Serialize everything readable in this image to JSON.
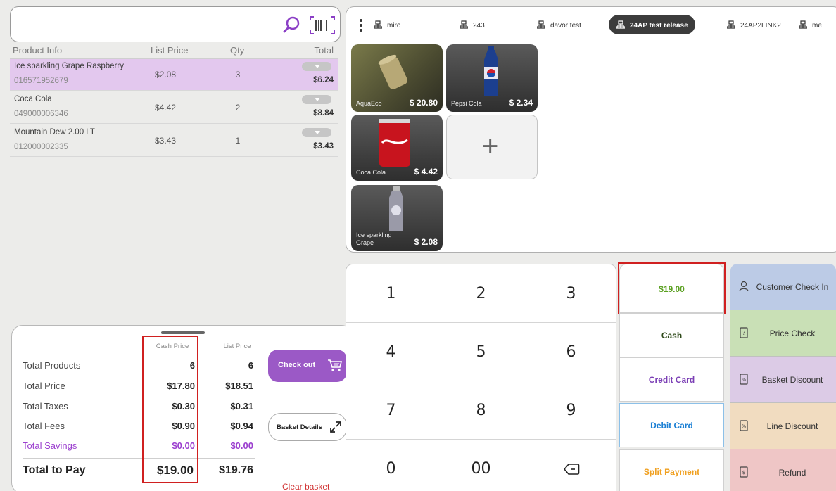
{
  "search": {
    "placeholder": ""
  },
  "basket": {
    "headers": {
      "product": "Product Info",
      "list_price": "List Price",
      "qty": "Qty",
      "total": "Total"
    },
    "rows": [
      {
        "name": "Ice sparkling Grape Raspberry",
        "code": "016571952679",
        "price": "$2.08",
        "qty": "3",
        "total": "$6.24",
        "selected": true
      },
      {
        "name": "Coca Cola",
        "code": "049000006346",
        "price": "$4.42",
        "qty": "2",
        "total": "$8.84",
        "selected": false
      },
      {
        "name": "Mountain Dew 2.00 LT",
        "code": "012000002335",
        "price": "$3.43",
        "qty": "1",
        "total": "$3.43",
        "selected": false
      }
    ]
  },
  "totals": {
    "cash_header": "Cash Price",
    "list_header": "List Price",
    "rows": [
      {
        "label": "Total Products",
        "cash": "6",
        "list": "6"
      },
      {
        "label": "Total Price",
        "cash": "$17.80",
        "list": "$18.51"
      },
      {
        "label": "Total Taxes",
        "cash": "$0.30",
        "list": "$0.31"
      },
      {
        "label": "Total Fees",
        "cash": "$0.90",
        "list": "$0.94"
      },
      {
        "label": "Total Savings",
        "cash": "$0.00",
        "list": "$0.00"
      }
    ],
    "grand_label": "Total to Pay",
    "grand_cash": "$19.00",
    "grand_list": "$19.76",
    "checkout_label": "Check out",
    "basket_details_label": "Basket Details",
    "clear_basket_label": "Clear basket"
  },
  "tabs": [
    {
      "label": "miro"
    },
    {
      "label": "243"
    },
    {
      "label": "davor test"
    },
    {
      "label": "24AP test release",
      "active": true
    },
    {
      "label": "24AP2LINK2"
    },
    {
      "label": "me"
    }
  ],
  "tiles": [
    {
      "name": "AquaEco",
      "price": "$ 20.80",
      "icon": "can-image"
    },
    {
      "name": "Pepsi Cola",
      "price": "$ 2.34",
      "icon": "bottle-image"
    },
    {
      "name": "Coca Cola",
      "price": "$ 4.42",
      "icon": "can-image"
    },
    {
      "name": "Ice sparkling Grape",
      "price": "$ 2.08",
      "icon": "bottle-image"
    }
  ],
  "add_tile": {
    "label": "+"
  },
  "numpad": [
    "1",
    "2",
    "3",
    "4",
    "5",
    "6",
    "7",
    "8",
    "9",
    "0",
    "00",
    "backspace"
  ],
  "payments": {
    "amount": "$19.00",
    "cash": "Cash",
    "credit": "Credit Card",
    "debit": "Debit Card",
    "split": "Split Payment"
  },
  "functions": [
    {
      "label": "Customer Check In",
      "icon": "person-icon",
      "color": "#bccbe6"
    },
    {
      "label": "Price Check",
      "icon": "tag-icon",
      "color": "#c9e0b6"
    },
    {
      "label": "Basket Discount",
      "icon": "discount-icon",
      "color": "#dccbe6"
    },
    {
      "label": "Line Discount",
      "icon": "discount-icon",
      "color": "#f1dcc0"
    },
    {
      "label": "Refund",
      "icon": "refund-icon",
      "color": "#efc6c6"
    }
  ],
  "colors": {
    "selected_row": "#e3c8ee",
    "checkout": "#9b59c6",
    "savings": "#9b3fcf",
    "amount": "#5aa020",
    "credit": "#7b3fb5",
    "debit": "#1a7fd4",
    "split": "#f0a020",
    "highlight_border": "#d02020"
  }
}
